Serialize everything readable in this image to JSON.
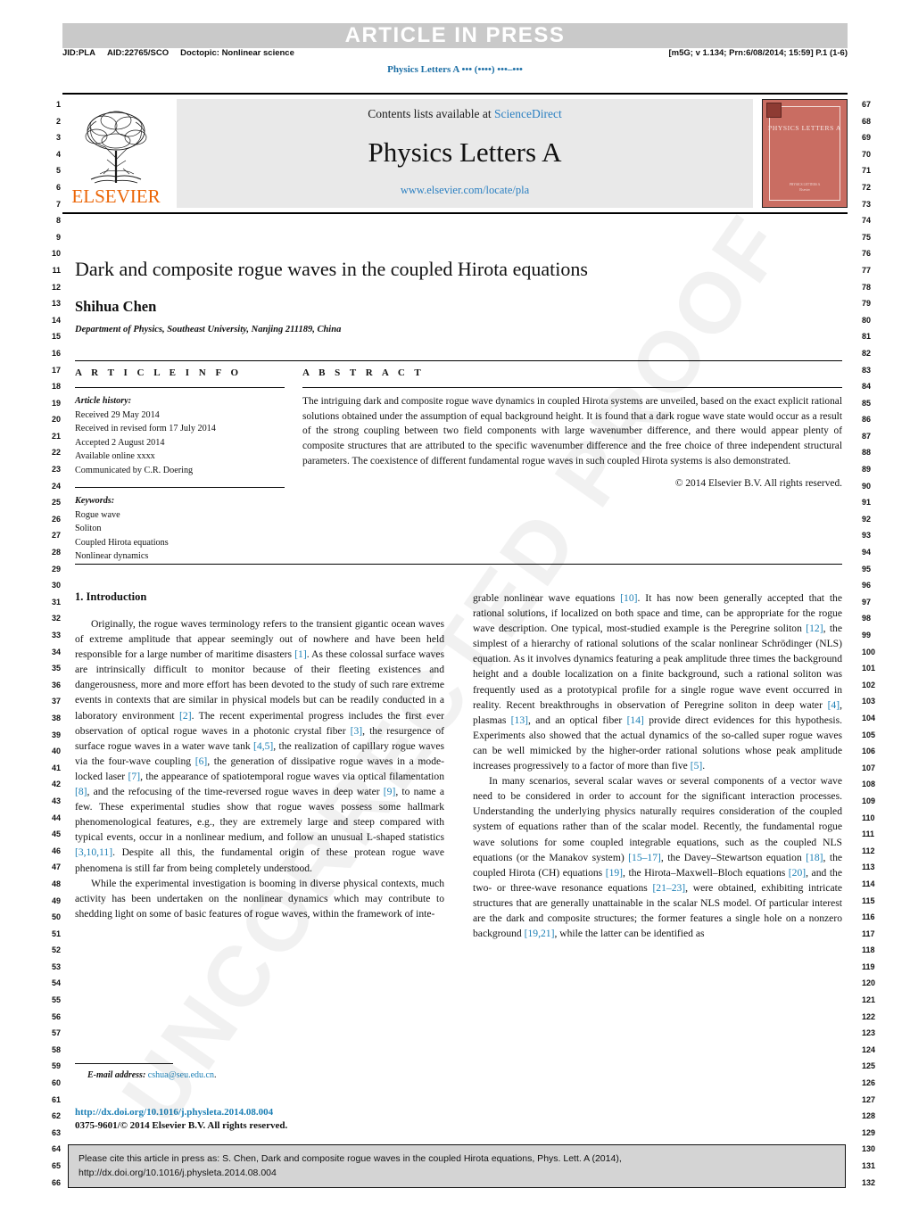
{
  "banner": {
    "text": "ARTICLE IN PRESS"
  },
  "proof_meta": {
    "jid": "JID:PLA",
    "aid": "AID:22765/SCO",
    "doctopic": "Doctopic: Nonlinear science",
    "right": "[m5G; v 1.134; Prn:6/08/2014; 15:59] P.1 (1-6)"
  },
  "running_head": "Physics Letters A ••• (••••) •••–•••",
  "masthead": {
    "contents_prefix": "Contents lists available at",
    "contents_link": "ScienceDirect",
    "journal_title": "Physics Letters A",
    "journal_url": "www.elsevier.com/locate/pla",
    "publisher_wordmark": "ELSEVIER",
    "cover_title": "PHYSICS LETTERS A",
    "cover_footer": "PHYSICS LETTERS A\nElsevier"
  },
  "title_block": {
    "title": "Dark and composite rogue waves in the coupled Hirota equations",
    "author": "Shihua Chen",
    "affiliation": "Department of Physics, Southeast University, Nanjing 211189, China"
  },
  "article_info": {
    "heading": "A R T I C L E   I N F O",
    "history_label": "Article history:",
    "history": [
      "Received 29 May 2014",
      "Received in revised form 17 July 2014",
      "Accepted 2 August 2014",
      "Available online xxxx",
      "Communicated by C.R. Doering"
    ],
    "keywords_label": "Keywords:",
    "keywords": [
      "Rogue wave",
      "Soliton",
      "Coupled Hirota equations",
      "Nonlinear dynamics"
    ]
  },
  "abstract": {
    "heading": "A B S T R A C T",
    "text": "The intriguing dark and composite rogue wave dynamics in coupled Hirota systems are unveiled, based on the exact explicit rational solutions obtained under the assumption of equal background height. It is found that a dark rogue wave state would occur as a result of the strong coupling between two field components with large wavenumber difference, and there would appear plenty of composite structures that are attributed to the specific wavenumber difference and the free choice of three independent structural parameters. The coexistence of different fundamental rogue waves in such coupled Hirota systems is also demonstrated.",
    "copyright": "© 2014 Elsevier B.V. All rights reserved."
  },
  "body": {
    "section_title": "1. Introduction",
    "left_paragraphs": [
      "Originally, the rogue waves terminology refers to the transient gigantic ocean waves of extreme amplitude that appear seemingly out of nowhere and have been held responsible for a large number of maritime disasters [1]. As these colossal surface waves are intrinsically difficult to monitor because of their fleeting existences and dangerousness, more and more effort has been devoted to the study of such rare extreme events in contexts that are similar in physical models but can be readily conducted in a laboratory environment [2]. The recent experimental progress includes the first ever observation of optical rogue waves in a photonic crystal fiber [3], the resurgence of surface rogue waves in a water wave tank [4,5], the realization of capillary rogue waves via the four-wave coupling [6], the generation of dissipative rogue waves in a mode-locked laser [7], the appearance of spatiotemporal rogue waves via optical filamentation [8], and the refocusing of the time-reversed rogue waves in deep water [9], to name a few. These experimental studies show that rogue waves possess some hallmark phenomenological features, e.g., they are extremely large and steep compared with typical events, occur in a nonlinear medium, and follow an unusual L-shaped statistics [3,10,11]. Despite all this, the fundamental origin of these protean rogue wave phenomena is still far from being completely understood.",
      "While the experimental investigation is booming in diverse physical contexts, much activity has been undertaken on the nonlinear dynamics which may contribute to shedding light on some of basic features of rogue waves, within the framework of inte-"
    ],
    "right_paragraphs": [
      "grable nonlinear wave equations [10]. It has now been generally accepted that the rational solutions, if localized on both space and time, can be appropriate for the rogue wave description. One typical, most-studied example is the Peregrine soliton [12], the simplest of a hierarchy of rational solutions of the scalar nonlinear Schrödinger (NLS) equation. As it involves dynamics featuring a peak amplitude three times the background height and a double localization on a finite background, such a rational soliton was frequently used as a prototypical profile for a single rogue wave event occurred in reality. Recent breakthroughs in observation of Peregrine soliton in deep water [4], plasmas [13], and an optical fiber [14] provide direct evidences for this hypothesis. Experiments also showed that the actual dynamics of the so-called super rogue waves can be well mimicked by the higher-order rational solutions whose peak amplitude increases progressively to a factor of more than five [5].",
      "In many scenarios, several scalar waves or several components of a vector wave need to be considered in order to account for the significant interaction processes. Understanding the underlying physics naturally requires consideration of the coupled system of equations rather than of the scalar model. Recently, the fundamental rogue wave solutions for some coupled integrable equations, such as the coupled NLS equations (or the Manakov system) [15–17], the Davey–Stewartson equation [18], the coupled Hirota (CH) equations [19], the Hirota–Maxwell–Bloch equations [20], and the two- or three-wave resonance equations [21–23], were obtained, exhibiting intricate structures that are generally unattainable in the scalar NLS model. Of particular interest are the dark and composite structures; the former features a single hole on a nonzero background [19,21], while the latter can be identified as"
    ]
  },
  "footnote": {
    "email_label": "E-mail address:",
    "email": "cshua@seu.edu.cn",
    "email_suffix": ".",
    "doi": "http://dx.doi.org/10.1016/j.physleta.2014.08.004",
    "issn": "0375-9601/© 2014 Elsevier B.V. All rights reserved."
  },
  "citation_box": {
    "line1": "Please cite this article in press as: S. Chen, Dark and composite rogue waves in the coupled Hirota equations, Phys. Lett. A (2014),",
    "line2": "http://dx.doi.org/10.1016/j.physleta.2014.08.004"
  },
  "watermark": {
    "text": "UNCORRECTED PROOF"
  },
  "line_numbers": {
    "left_start": 1,
    "left_end": 66,
    "right_start": 67,
    "right_end": 132
  },
  "colors": {
    "link": "#2a7fc1",
    "reference": "#1b7fb5",
    "elsevier_orange": "#eb6608",
    "banner_bg": "#c9c9c9",
    "panel_bg": "#e9e9e9",
    "cover_red": "#c96d62",
    "citation_bg": "#d4d4d4"
  }
}
